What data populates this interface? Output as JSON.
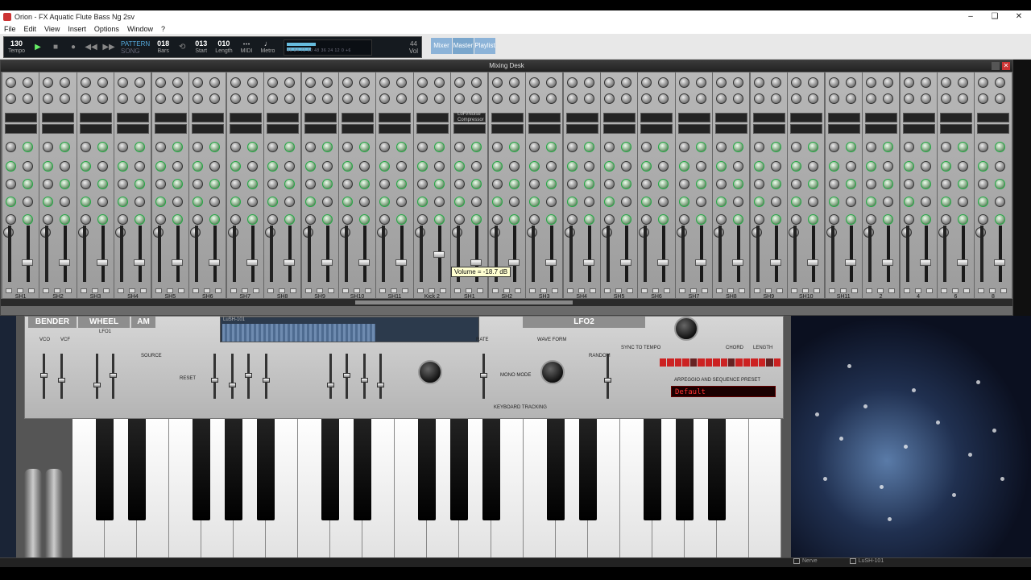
{
  "window": {
    "title": "Orion - FX Aquatic Flute Bass Ng 2sv",
    "controls": [
      "–",
      "❑",
      "✕"
    ]
  },
  "menu": [
    "File",
    "Edit",
    "View",
    "Insert",
    "Options",
    "Window",
    "?"
  ],
  "transport": {
    "tempo_value": "130",
    "tempo_label": "Tempo",
    "pattern_label": "PATTERN",
    "song_label": "SONG",
    "bars_value": "018",
    "bars_label": "Bars",
    "start_value": "013",
    "start_label": "Start",
    "length_value": "010",
    "length_label": "Length",
    "midi_label": "MIDI",
    "metro_label": "Metro",
    "vol_label": "Vol",
    "vol_value": "44",
    "vu_scale": "96 84 72 60 48 36 24 12 0 +6"
  },
  "views": [
    "Mixer",
    "Master",
    "Playlist"
  ],
  "mixer": {
    "title": "Mixing Desk",
    "insert_label_1": "LoFi/Noise",
    "insert_label_2": "Compressor",
    "channels": [
      "SH1",
      "SH2",
      "SH3",
      "SH4",
      "SH5",
      "SH6",
      "SH7",
      "SH8",
      "SH9",
      "SH10",
      "SH11",
      "Kick 2",
      "SH1",
      "SH2",
      "SH3",
      "SH4",
      "SH5",
      "SH6",
      "SH7",
      "SH8",
      "SH9",
      "SH10",
      "SH11",
      "2",
      "4",
      "6",
      "8"
    ],
    "tooltip": "Volume = -18.7 dB"
  },
  "synth": {
    "sections": {
      "bender": "BENDER",
      "wheel": "WHEEL",
      "am": "AM",
      "lfo2": "LFO2"
    },
    "labels": {
      "lfo1": "LFO1",
      "vco": "VCO",
      "vcf": "VCF",
      "source": "SOURCE",
      "reset": "RESET",
      "rate": "RATE",
      "waveform": "WAVE FORM",
      "sync": "SYNC TO TEMPO",
      "mono": "MONO MODE",
      "kbd": "KEYBOARD TRACKING",
      "arp": "ARPEGGIO AND SEQUENCE PRESET",
      "chord": "CHORD",
      "length": "LENGTH",
      "random": "RANDOM",
      "noise": "NOISE"
    },
    "preset": "Default",
    "embedded": {
      "name": "LuSH-101",
      "track": "Kick 2"
    }
  },
  "status": {
    "items": [
      "Nerve",
      "LuSH-101"
    ]
  }
}
